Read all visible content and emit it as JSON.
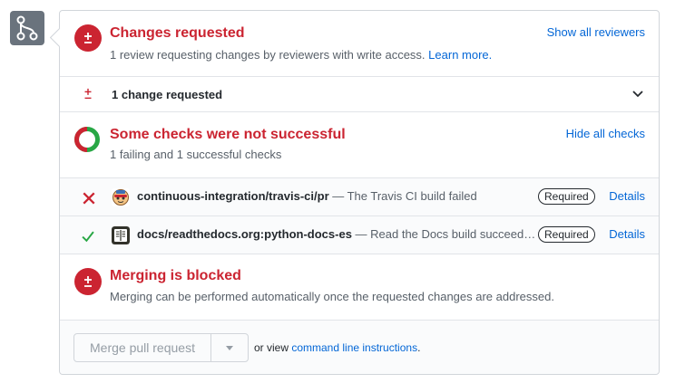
{
  "colors": {
    "danger": "#cb2431",
    "success": "#28a745",
    "link": "#0366d6",
    "muted": "#586069"
  },
  "review": {
    "title": "Changes requested",
    "description": "1 review requesting changes by reviewers with write access.",
    "learn_more": "Learn more.",
    "show_all": "Show all reviewers"
  },
  "change_summary": {
    "label": "1 change requested",
    "icon": "plus-minus-icon"
  },
  "checks": {
    "title": "Some checks were not successful",
    "description": "1 failing and 1 successful checks",
    "hide_all": "Hide all checks",
    "items": [
      {
        "status": "failed",
        "name": "continuous-integration/travis-ci/pr",
        "message": " — The Travis CI build failed",
        "required": "Required",
        "details": "Details"
      },
      {
        "status": "success",
        "name": "docs/readthedocs.org:python-docs-es",
        "message": " — Read the Docs build succeeded!",
        "required": "Required",
        "details": "Details"
      }
    ]
  },
  "merge": {
    "title": "Merging is blocked",
    "description": "Merging can be performed automatically once the requested changes are addressed.",
    "button": "Merge pull request",
    "or_view": "or view ",
    "cli_link": "command line instructions",
    "period": "."
  }
}
